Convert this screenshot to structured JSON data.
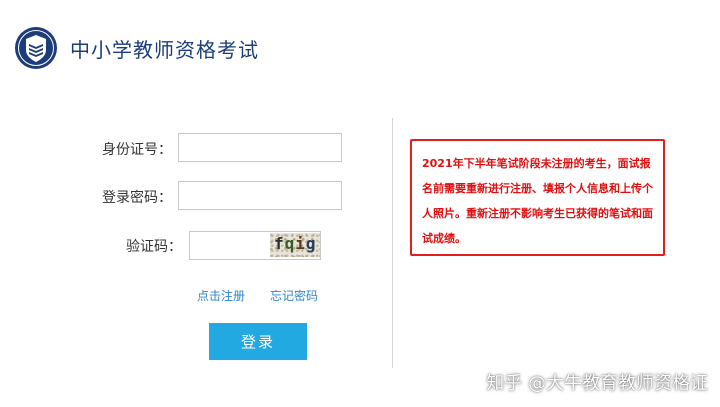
{
  "header": {
    "title": "中小学教师资格考试",
    "logo_icon": "shield-book-icon",
    "brand_color": "#1d3d7a"
  },
  "form": {
    "id_label": "身份证号：",
    "id_value": "",
    "password_label": "登录密码：",
    "password_value": "",
    "captcha_label": "验证码：",
    "captcha_value": "",
    "captcha_chars": [
      "f",
      "q",
      "i",
      "g"
    ]
  },
  "links": {
    "register": "点击注册",
    "forgot_password": "忘记密码"
  },
  "login_button": {
    "label": "登录",
    "color": "#23a9e1"
  },
  "notice": {
    "text": "2021年下半年笔试阶段未注册的考生，面试报名前需要重新进行注册、填报个人信息和上传个人照片。重新注册不影响考生已获得的笔试和面试成绩。",
    "color": "#e01010"
  },
  "watermark": {
    "text": "知乎 @大牛教育教师资格证"
  }
}
